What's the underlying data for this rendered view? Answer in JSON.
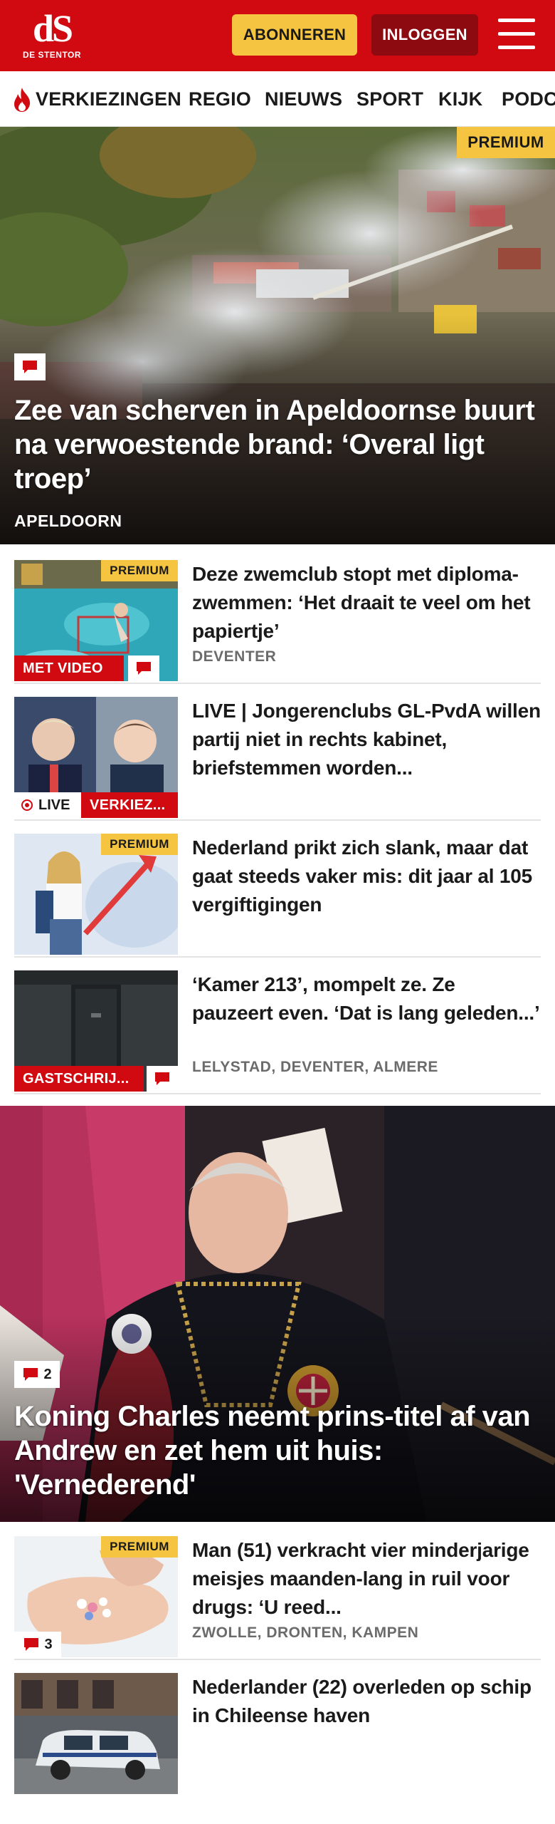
{
  "header": {
    "logo_text": "dS",
    "logo_sub": "DE STENTOR",
    "subscribe_label": "ABONNEREN",
    "login_label": "INLOGGEN",
    "brand_color": "#d10a11"
  },
  "nav": {
    "items": [
      "VERKIEZINGEN",
      "REGIO",
      "NIEUWS",
      "SPORT",
      "KIJK",
      "PODC"
    ]
  },
  "hero": {
    "premium": "PREMIUM",
    "title": "Zee van scherven in Apeldoornse buurt na verwoestende brand: ‘Overal ligt troep’",
    "location": "APELDOORN"
  },
  "articles": [
    {
      "premium": "PREMIUM",
      "label": "MET VIDEO",
      "title": "Deze zwemclub stopt met diploma-zwemmen: ‘Het draait te veel om het papiertje’",
      "location": "DEVENTER"
    },
    {
      "live": "LIVE",
      "label": "VERKIEZ...",
      "title": "LIVE | Jongerenclubs GL-PvdA willen partij niet in rechts kabinet, briefstemmen worden..."
    },
    {
      "premium": "PREMIUM",
      "title": "Nederland prikt zich slank, maar dat gaat steeds vaker mis: dit jaar al 105 vergiftigingen"
    },
    {
      "label": "GASTSCHRIJ...",
      "title": "‘Kamer 213’, mompelt ze. Ze pauzeert even. ‘Dat is lang geleden...’",
      "location": "LELYSTAD, DEVENTER, ALMERE"
    }
  ],
  "hero2": {
    "comments": "2",
    "title": "Koning Charles neemt prins-titel af van Andrew en zet hem uit huis: 'Vernederend'"
  },
  "articles2": [
    {
      "premium": "PREMIUM",
      "comments": "3",
      "title": "Man (51) verkracht vier minderjarige meisjes maanden-lang in ruil voor drugs: ‘U reed...",
      "location": "ZWOLLE, DRONTEN, KAMPEN"
    },
    {
      "title": "Nederlander (22) overleden op schip in Chileense haven"
    }
  ]
}
